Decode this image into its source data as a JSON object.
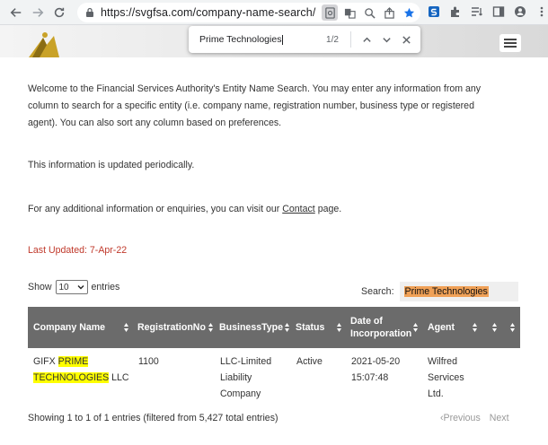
{
  "browser": {
    "url": "https://svgfsa.com/company-name-search/"
  },
  "find_bar": {
    "query": "Prime Technologies",
    "count": "1/2"
  },
  "content": {
    "p1": "Welcome to the Financial Services Authority's Entity Name Search. You may enter any information from any column to search for a specific entity (i.e. company name, registration number, business type or registered agent). You can also sort any column based on preferences.",
    "p2": "This information is updated periodically.",
    "p3_before": "For any additional information or enquiries, you can visit our ",
    "p3_link": "Contact",
    "p3_after": " page.",
    "last_updated": "Last Updated:  7-Apr-22"
  },
  "table_controls": {
    "show_label": "Show",
    "show_value": "10",
    "entries_label": "entries",
    "search_label": "Search:",
    "search_value": "Prime Technologies"
  },
  "table": {
    "headers": {
      "company_name": "Company Name",
      "registration_no": "RegistrationNo",
      "business_type": "BusinessType",
      "status": "Status",
      "date_line1": "Date of",
      "date_line2": "Incorporation",
      "agent": "Agent"
    },
    "row": {
      "company_prefix": "GIFX ",
      "company_hl1": "PRIME",
      "company_hl2": "TECHNOLOGIES",
      "company_suffix": " LLC",
      "registration_no": "1100",
      "business_type_1": "LLC-Limited",
      "business_type_2": "Liability",
      "business_type_3": "Company",
      "status": "Active",
      "date_1": "2021-05-20",
      "date_2": "15:07:48",
      "agent_1": "Wilfred",
      "agent_2": "Services",
      "agent_3": "Ltd."
    }
  },
  "footer": {
    "info": "Showing 1 to 1 of 1 entries (filtered from 5,427 total entries)",
    "previous": "Previous",
    "next": "Next"
  },
  "colors": {
    "header_bg": "#6b6b6b",
    "updated_text": "#c0392b",
    "find_highlight": "#f0a157",
    "match_highlight": "#ffff00"
  }
}
